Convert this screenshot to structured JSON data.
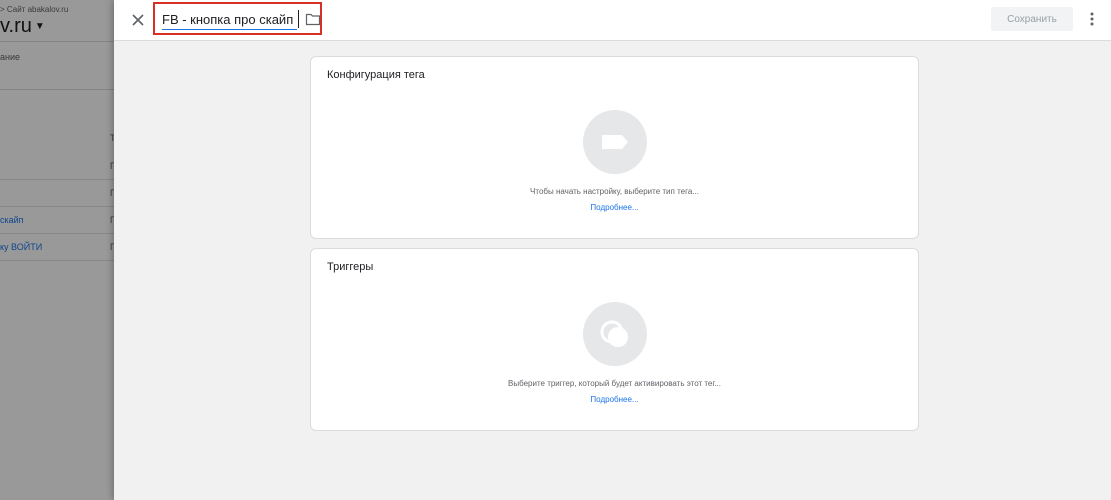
{
  "background": {
    "breadcrumb": "> Сайт abakalov.ru",
    "container_name": "v.ru",
    "tab_label": "ание",
    "column_header": "Т",
    "rows": [
      {
        "name": "",
        "type": "П"
      },
      {
        "name": "",
        "type": "П"
      },
      {
        "name": "скайп",
        "type": "П"
      },
      {
        "name": "ку ВОЙТИ",
        "type": "П"
      }
    ]
  },
  "header": {
    "tag_name": "FB - кнопка про скайп",
    "save_label": "Сохранить",
    "close_icon": "close-icon",
    "folder_icon": "folder-icon",
    "more_icon": "more-vert-icon"
  },
  "tag_config": {
    "title": "Конфигурация тега",
    "hint": "Чтобы начать настройку, выберите тип тега...",
    "link": "Подробнее...",
    "icon": "tag-icon"
  },
  "triggers": {
    "title": "Триггеры",
    "hint": "Выберите триггер, который будет активировать этот тег...",
    "link": "Подробнее...",
    "icon": "trigger-icon"
  },
  "colors": {
    "highlight_border": "#d93025",
    "link": "#1a73e8",
    "panel_bg": "#f1f1f2",
    "icon_circle": "#e6e7e9"
  }
}
